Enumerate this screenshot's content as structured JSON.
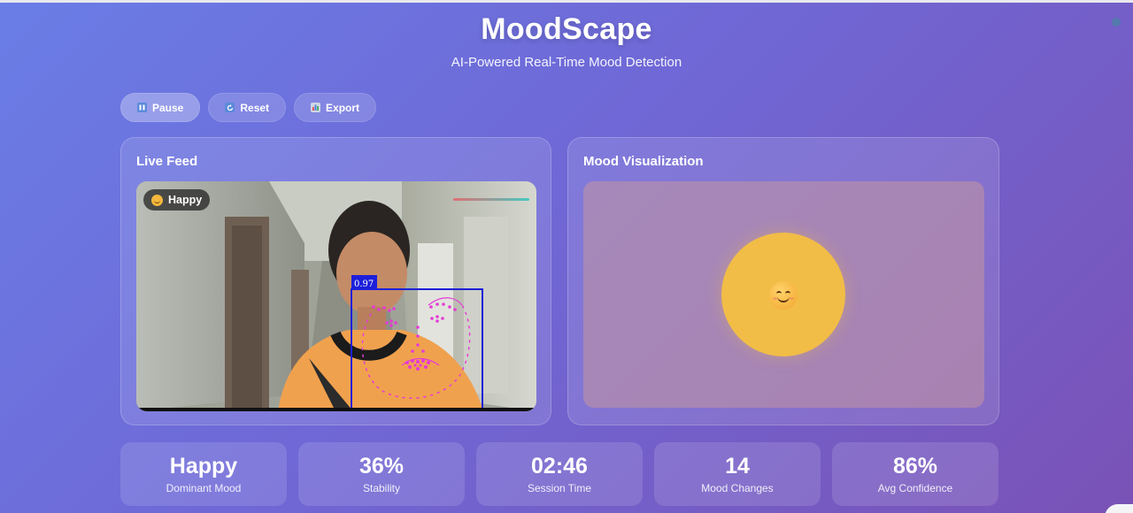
{
  "app": {
    "title": "MoodScape",
    "subtitle": "AI-Powered Real-Time Mood Detection"
  },
  "controls": [
    {
      "label": "Pause",
      "icon": "pause-icon"
    },
    {
      "label": "Reset",
      "icon": "reset-icon"
    },
    {
      "label": "Export",
      "icon": "chart-icon"
    }
  ],
  "live_feed": {
    "title": "Live Feed",
    "mood_badge": "Happy",
    "detection_confidence": "0.97"
  },
  "mood_visualization": {
    "title": "Mood Visualization",
    "orb_color": "#f1bd47",
    "emoji": "smiling-face"
  },
  "stats": [
    {
      "value": "Happy",
      "label": "Dominant Mood"
    },
    {
      "value": "36%",
      "label": "Stability"
    },
    {
      "value": "02:46",
      "label": "Session Time"
    },
    {
      "value": "14",
      "label": "Mood Changes"
    },
    {
      "value": "86%",
      "label": "Avg Confidence"
    }
  ]
}
